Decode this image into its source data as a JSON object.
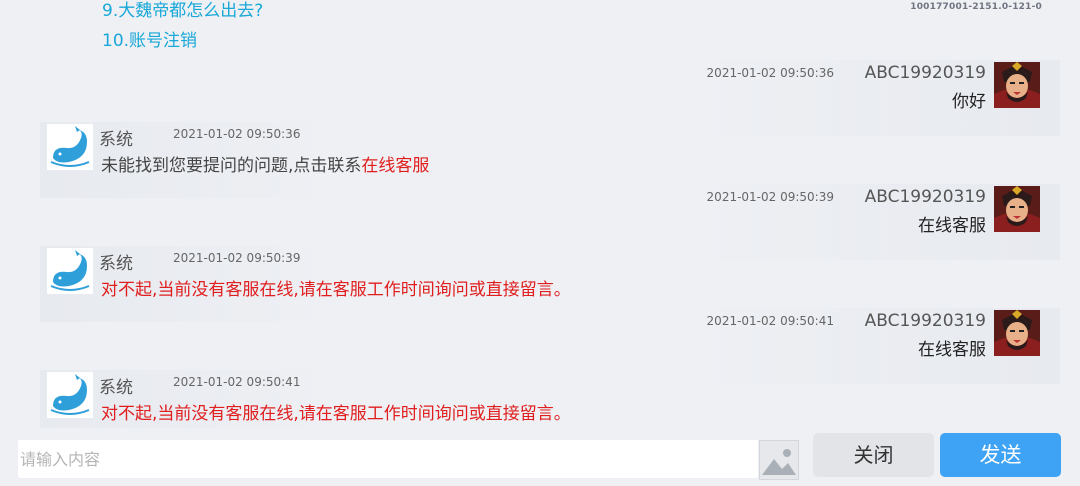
{
  "faq": {
    "item9": "9.大魏帝都怎么出去?",
    "item10": "10.账号注销"
  },
  "doc_id": "100177001-2151.0-121-0",
  "messages": [
    {
      "side": "user",
      "name": "ABC19920319",
      "time": "2021-01-02 09:50:36",
      "text": "你好",
      "avatar": "warrior-avatar"
    },
    {
      "side": "system",
      "name": "系统",
      "time": "2021-01-02 09:50:36",
      "text_prefix": "未能找到您要提问的问题,点击联系",
      "link_text": "在线客服",
      "avatar": "whale-avatar"
    },
    {
      "side": "user",
      "name": "ABC19920319",
      "time": "2021-01-02 09:50:39",
      "text": "在线客服",
      "avatar": "warrior-avatar"
    },
    {
      "side": "system",
      "name": "系统",
      "time": "2021-01-02 09:50:39",
      "text": "对不起,当前没有客服在线,请在客服工作时间询问或直接留言。",
      "avatar": "whale-avatar"
    },
    {
      "side": "user",
      "name": "ABC19920319",
      "time": "2021-01-02 09:50:41",
      "text": "在线客服",
      "avatar": "warrior-avatar"
    },
    {
      "side": "system",
      "name": "系统",
      "time": "2021-01-02 09:50:41",
      "text": "对不起,当前没有客服在线,请在客服工作时间询问或直接留言。",
      "avatar": "whale-avatar"
    }
  ],
  "input": {
    "placeholder": "请输入内容",
    "value": ""
  },
  "buttons": {
    "image_icon": "image-icon",
    "close_label": "关闭",
    "send_label": "发送"
  },
  "colors": {
    "faq_link": "#19a8d8",
    "system_red": "#e01e1e",
    "send_button": "#3fa3f5",
    "background": "#eef0f4"
  }
}
